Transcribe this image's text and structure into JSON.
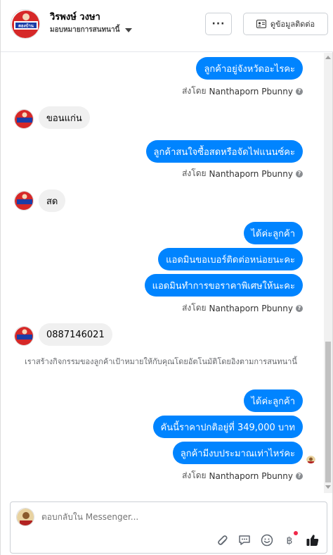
{
  "header": {
    "name": "วิรพงษ์ วงษา",
    "subtitle": "มอบหมายการสนทนานี้",
    "more_label": "···",
    "contact_label": "ดูข้อมูลติดต่อ",
    "avatar_text": "ตองบ้าน"
  },
  "messages": {
    "m1": "ลูกค้าอยู่จังหวัดอะไรคะ",
    "m2": "ขอนแก่น",
    "m3": "ลูกค้าสนใจซื้อสดหรือจัดไฟแนนซ์คะ",
    "m4": "สด",
    "m5": "ได้ค่ะลูกค้า",
    "m6": "แอดมินขอเบอร์ติดต่อหน่อยนะคะ",
    "m7": "แอดมินทำการขอราคาพิเศษให้นะคะ",
    "m8": "0887146021",
    "m9": "ได้ค่ะลูกค้า",
    "m10": "คันนี้ราคาปกติอยู่ที่ 349,000 บาท",
    "m11": "ลูกค้ามีงบประมาณเท่าไหร่คะ"
  },
  "sent_by": {
    "prefix": "ส่งโดย",
    "name": "Nanthaporn Pbunny"
  },
  "system_note": "เราสร้างกิจกรรมของลูกค้าเป้าหมายให้กับคุณโดยอัตโนมัติโดยอิงตามการสนทนานี้",
  "composer": {
    "placeholder": "ตอบกลับใน Messenger..."
  },
  "colors": {
    "accent": "#0084ff",
    "incoming_bubble": "#f0f0f0",
    "notification_dot": "#f02849"
  },
  "icons": [
    "more-icon",
    "contact-card-icon",
    "attach-icon",
    "chat-bubble-icon",
    "emoji-icon",
    "baht-icon",
    "thumbs-up-icon"
  ]
}
